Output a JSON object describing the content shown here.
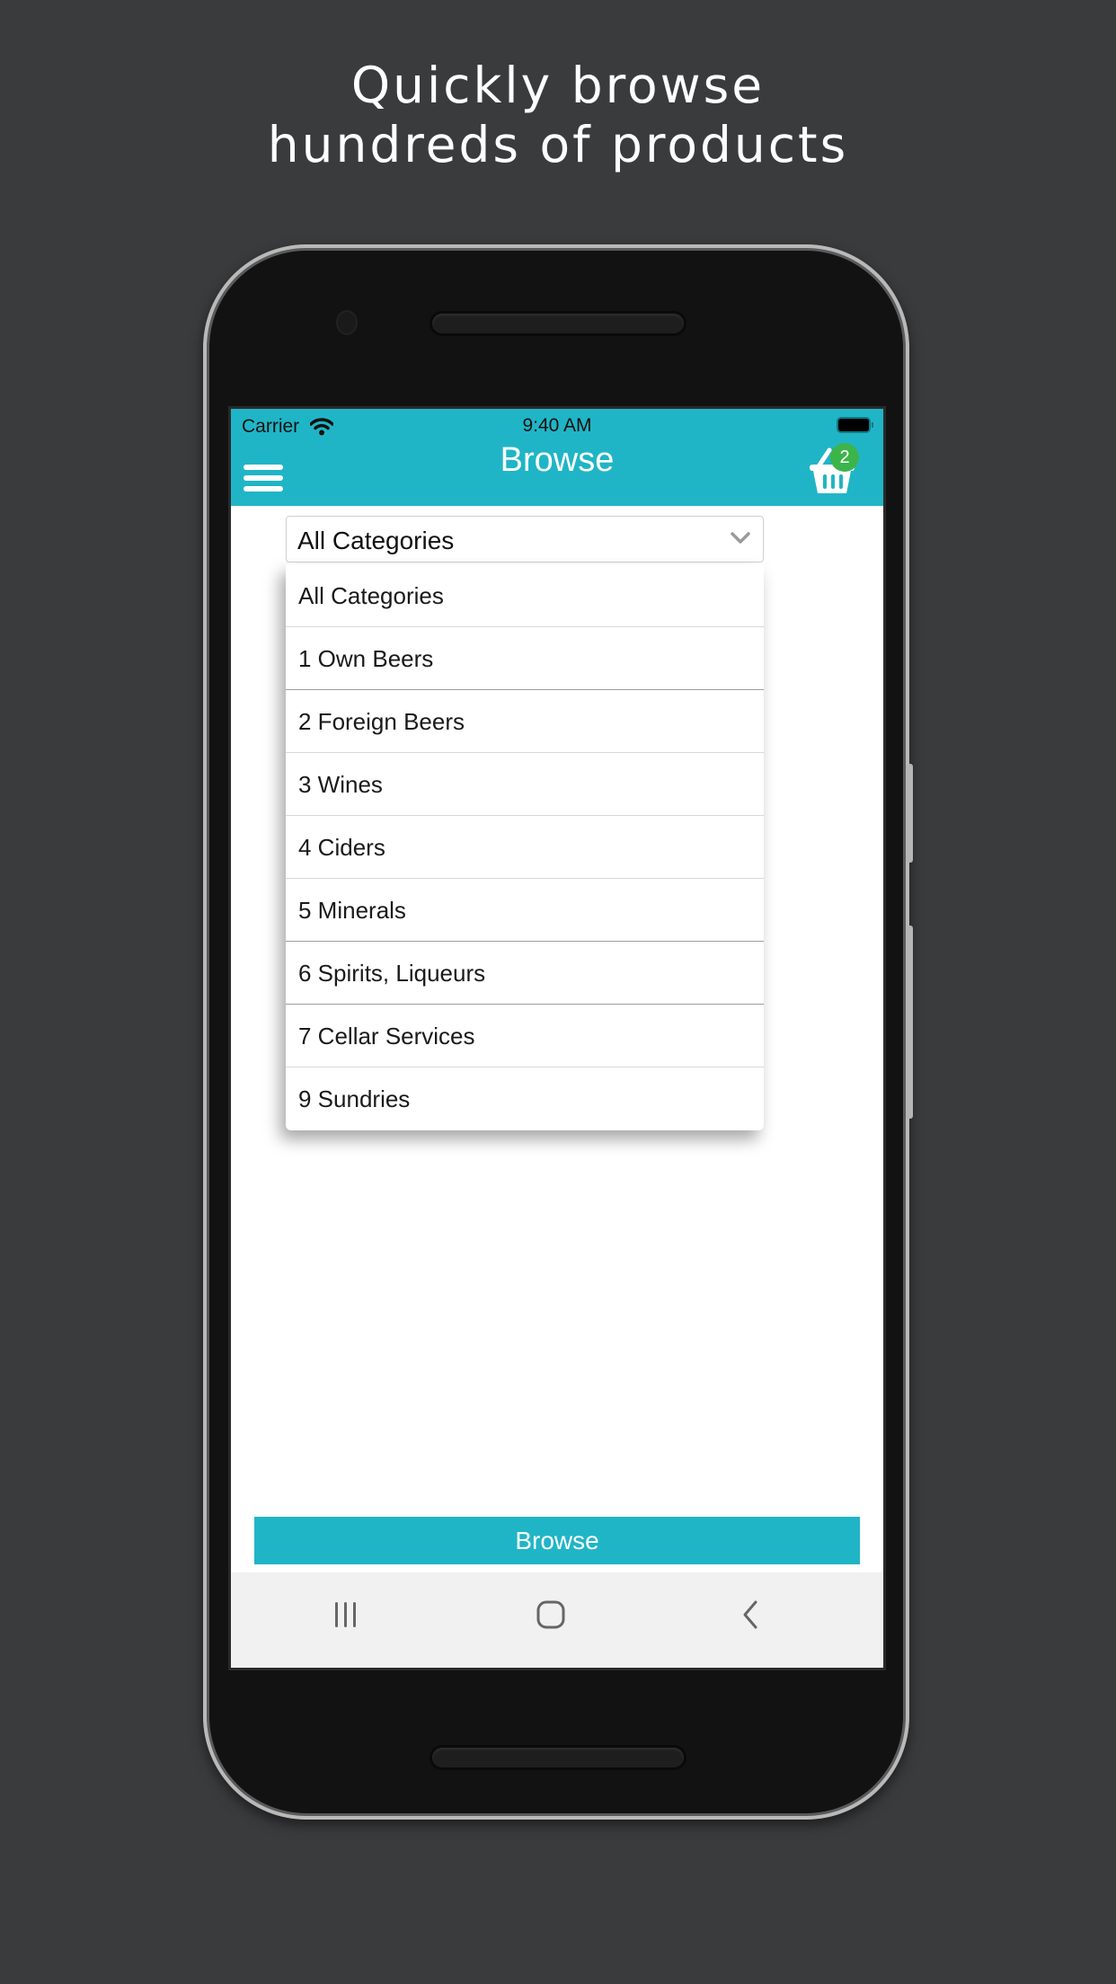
{
  "promo": {
    "line1": "Quickly browse",
    "line2": "hundreds of products"
  },
  "status_bar": {
    "carrier": "Carrier",
    "time": "9:40 AM",
    "wifi_icon": "wifi-icon",
    "battery_icon": "battery-icon"
  },
  "header": {
    "title": "Browse",
    "menu_icon": "hamburger-menu-icon",
    "cart_icon": "shopping-basket-icon",
    "cart_count": "2"
  },
  "category_select": {
    "selected": "All Categories",
    "chevron_icon": "chevron-down-icon",
    "options": [
      "All Categories",
      "1 Own Beers",
      "2 Foreign Beers",
      "3 Wines",
      "4 Ciders",
      "5 Minerals",
      "6 Spirits, Liqueurs",
      "7 Cellar Services",
      "9 Sundries"
    ]
  },
  "browse_button": {
    "label": "Browse"
  },
  "android_nav": {
    "recents_icon": "recent-apps-icon",
    "home_icon": "home-icon",
    "back_icon": "back-icon"
  },
  "colors": {
    "accent": "#20b5c6",
    "badge": "#3cb44a",
    "background": "#3a3b3d"
  }
}
